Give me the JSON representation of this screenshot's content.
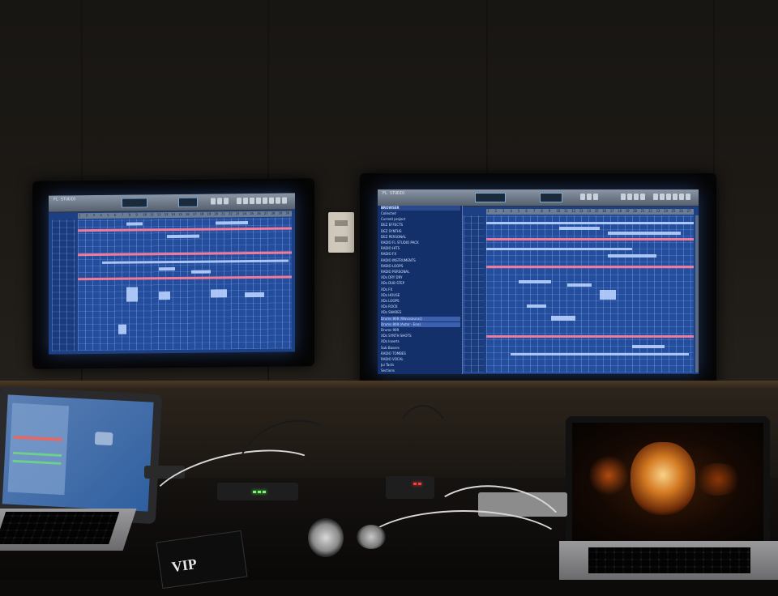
{
  "scene": {
    "description_colors": {
      "wall": "#1c1915",
      "screen_blue": "#244d9c",
      "accent_pink": "#f07a9a",
      "led_green": "#6cff6c"
    }
  },
  "left_monitor": {
    "app_title": "FL STUDIO",
    "ruler_ticks": [
      "1",
      "2",
      "3",
      "4",
      "5",
      "6",
      "7",
      "8",
      "9",
      "10",
      "11",
      "12",
      "13",
      "14",
      "15",
      "16",
      "17",
      "18",
      "19",
      "20",
      "21",
      "22",
      "23",
      "24",
      "25",
      "26",
      "27",
      "28",
      "29",
      "30"
    ]
  },
  "right_monitor": {
    "app_title": "FL STUDIO",
    "browser_header": "BROWSER",
    "browser_items": [
      "Collected",
      "Current project",
      "DEZ EFFECTS",
      "DEZ SYNTHS",
      "DEZ PERSONAL",
      "RADIO FL STUDIO PACK",
      "RADIO HITS",
      "RADIO FX",
      "RADIO INSTRUMENTS",
      "RADIO LOOPS",
      "RADIO PERSONAL",
      "XDs DRY DRY",
      "XDs DUB STEP",
      "XDs FX",
      "XDs HOUSE",
      "XDs LOOPS",
      "XDs ROCK",
      "XDs SNARES",
      "Drums 808 (Wavosaurus)",
      "Drums 808 (Autor - Eno)",
      "Drums 909",
      "XDs SYNTH SHOTS",
      "XDs Inserts",
      "Sub Basses",
      "RADIO TOMBES",
      "RADIO VOCAL",
      "Jui Tacts",
      "Sections"
    ],
    "ruler_ticks": [
      "1",
      "2",
      "3",
      "4",
      "5",
      "6",
      "7",
      "8",
      "9",
      "10",
      "11",
      "12",
      "13",
      "14",
      "15",
      "16",
      "17",
      "18",
      "19",
      "20",
      "21",
      "22",
      "23",
      "24",
      "25",
      "26",
      "27"
    ]
  },
  "vip_card": {
    "text": "VIP"
  }
}
